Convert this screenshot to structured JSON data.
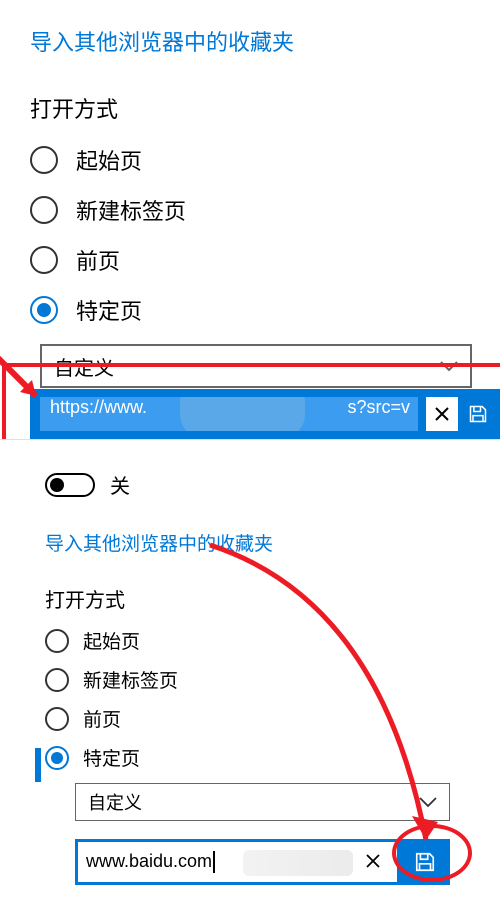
{
  "top": {
    "import_link": "导入其他浏览器中的收藏夹",
    "open_with_title": "打开方式",
    "radios": [
      {
        "label": "起始页",
        "selected": false
      },
      {
        "label": "新建标签页",
        "selected": false
      },
      {
        "label": "前页",
        "selected": false
      },
      {
        "label": "特定页",
        "selected": true
      }
    ],
    "select_label": "自定义",
    "url_value": "https://www.",
    "url_suffix": "s?src=v"
  },
  "bottom": {
    "toggle_label": "关",
    "toggle_state": "off",
    "import_link": "导入其他浏览器中的收藏夹",
    "open_with_title": "打开方式",
    "radios": [
      {
        "label": "起始页",
        "selected": false
      },
      {
        "label": "新建标签页",
        "selected": false
      },
      {
        "label": "前页",
        "selected": false
      },
      {
        "label": "特定页",
        "selected": true
      }
    ],
    "select_label": "自定义",
    "url_value": "www.baidu.com"
  },
  "colors": {
    "accent": "#0078d7",
    "annotation": "#ed1c24"
  }
}
